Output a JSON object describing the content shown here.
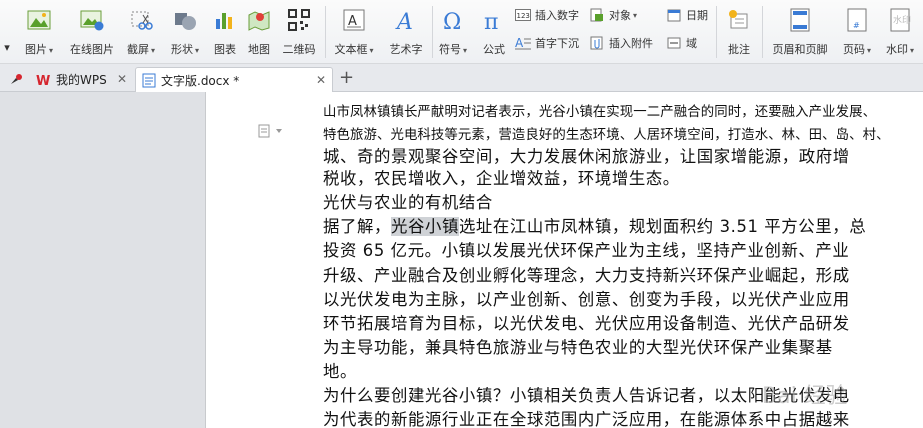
{
  "ribbon": {
    "picture": "图片",
    "online_picture": "在线图片",
    "screenshot": "截屏",
    "shapes": "形状",
    "chart": "图表",
    "map": "地图",
    "qrcode": "二维码",
    "textbox": "文本框",
    "wordart": "艺术字",
    "symbol": "符号",
    "formula": "公式",
    "insert_number": "插入数字",
    "object": "对象",
    "date": "日期",
    "dropcap": "首字下沉",
    "insert_attachment": "插入附件",
    "field": "域",
    "comment": "批注",
    "header_footer": "页眉和页脚",
    "page_number": "页码",
    "watermark": "水印"
  },
  "tabs": [
    {
      "label": "我的WPS"
    },
    {
      "label": "文字版.docx *"
    }
  ],
  "document": {
    "lines": [
      {
        "text": "山市凤林镇镇长严献明对记者表示，光谷小镇在实现一二产融合的同时，还要融入产业发展、"
      },
      {
        "text": "特色旅游、光电科技等元素，营造良好的生态环境、人居环境空间，打造水、林、田、岛、村、"
      },
      {
        "text": "城、奇的景观聚谷空间，大力发展休闲旅游业，让国家增能源，政府增"
      },
      {
        "text": "税收，农民增收入，企业增效益，环境增生态。"
      },
      {
        "text": "光伏与农业的有机结合"
      },
      {
        "pre": "据了解，",
        "hl": "光谷小镇",
        "post": "选址在江山市凤林镇，规划面积约 3.51 平方公里，总"
      },
      {
        "text": "投资 65 亿元。小镇以发展光伏环保产业为主线，坚持产业创新、产业"
      },
      {
        "text": "升级、产业融合及创业孵化等理念，大力支持新兴环保产业崛起，形成"
      },
      {
        "text": "以光伏发电为主脉，以产业创新、创意、创变为手段，以光伏产业应用"
      },
      {
        "text": "环节拓展培育为目标，以光伏发电、光伏应用设备制造、光伏产品研发"
      },
      {
        "text": "为主导功能，兼具特色旅游业与特色农业的大型光伏环保产业集聚基"
      },
      {
        "text": "地。"
      },
      {
        "text": "为什么要创建光谷小镇？小镇相关负责人告诉记者，以太阳能光伏发电"
      },
      {
        "text": "为代表的新能源行业正在全球范围内广泛应用，在能源体系中占据越来"
      }
    ]
  },
  "watermark_text": "Bai 经验",
  "colors": {
    "wps_red": "#d6262f",
    "ribbon_blue": "#3a7bd5"
  }
}
